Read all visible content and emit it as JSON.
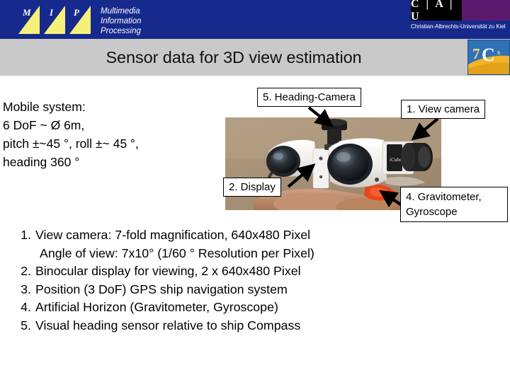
{
  "header": {
    "mip_letters": [
      "M",
      "I",
      "P"
    ],
    "mip_name_lines": [
      "Multimedia",
      "Information",
      "Processing"
    ],
    "cau_letters": "C | A | U",
    "cau_subtitle": "Christian-Albrechts-Universität zu Kiel",
    "band_color": "#16298c",
    "mip_triangle_color": "#f5f07a",
    "cau_purple": "#5c1a6e"
  },
  "title": {
    "text": "Sensor data for 3D view estimation",
    "bar_color": "#c9c9c9",
    "logo_label": "7C's"
  },
  "specs": {
    "lines": [
      "Mobile system:",
      "6 DoF  ~ Ø 6m,",
      "pitch ±~45 °, roll  ±~ 45 °,",
      "heading 360 °"
    ]
  },
  "callouts": [
    {
      "id": "heading-camera",
      "label": "5. Heading-Camera"
    },
    {
      "id": "view-camera",
      "label": "1. View camera"
    },
    {
      "id": "display",
      "label": "2. Display"
    },
    {
      "id": "gravitometer",
      "label": "4. Gravitometer, Gyroscope"
    }
  ],
  "photo": {
    "alt": "Binocular stereo camera rig held in a hand",
    "background_color": "#a89279",
    "housing_color": "#f2f0ec",
    "lens_color": "#1a1a1a",
    "hand_color": "#c79b7a",
    "accent_color": "#e8461c"
  },
  "features": [
    {
      "num": "1.",
      "text": "View camera: 7-fold magnification, 640x480 Pixel",
      "sub": "Angle of view: 7x10° (1/60 ° Resolution per Pixel)"
    },
    {
      "num": "2.",
      "text": "Binocular display for viewing, 2 x 640x480 Pixel",
      "sub": ""
    },
    {
      "num": "3.",
      "text": "Position (3 DoF) GPS ship navigation system",
      "sub": ""
    },
    {
      "num": "4.",
      "text": "Artificial Horizon (Gravitometer, Gyroscope)",
      "sub": ""
    },
    {
      "num": "5.",
      "text": "Visual heading sensor relative to ship Compass",
      "sub": ""
    }
  ]
}
